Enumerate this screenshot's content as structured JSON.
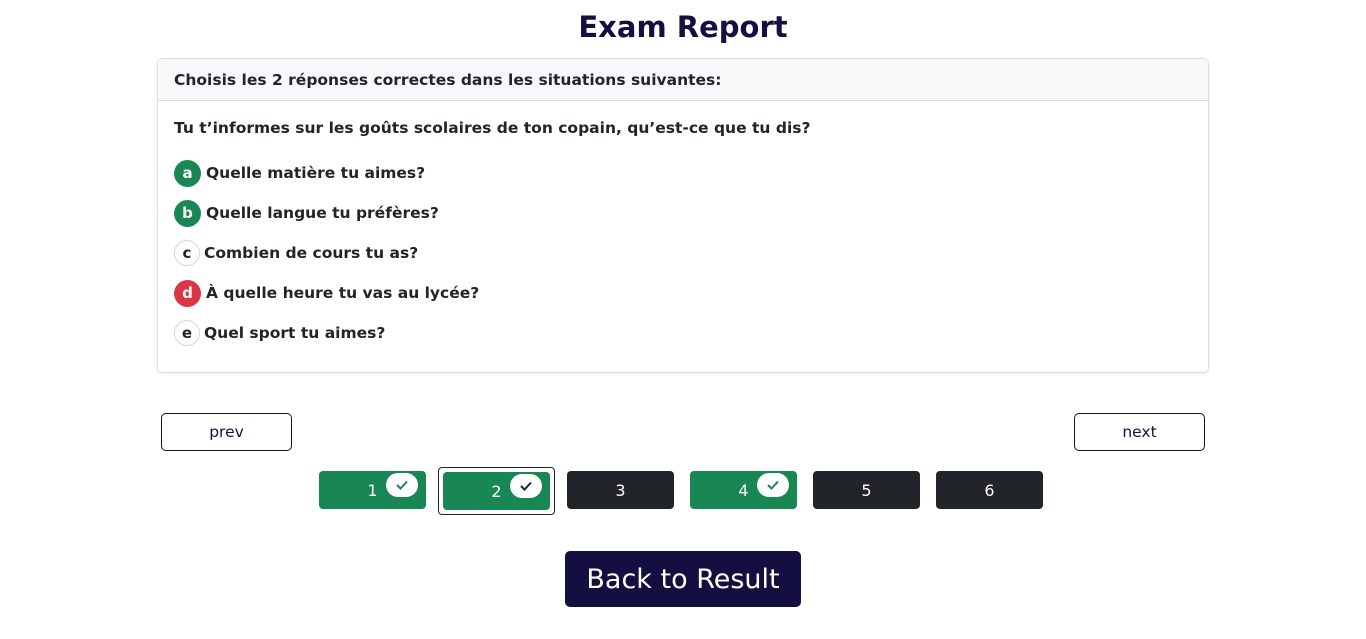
{
  "page": {
    "title": "Exam Report"
  },
  "card": {
    "header": "Choisis les 2 réponses correctes dans les situations suivantes:",
    "question": "Tu t’informes sur les goûts scolaires de ton copain, qu’est-ce que tu dis?",
    "options": [
      {
        "letter": "a",
        "text": "Quelle matière tu aimes?",
        "state": "correct"
      },
      {
        "letter": "b",
        "text": "Quelle langue tu préfères?",
        "state": "correct"
      },
      {
        "letter": "c",
        "text": "Combien de cours tu as?",
        "state": "none"
      },
      {
        "letter": "d",
        "text": "À quelle heure tu vas au lycée?",
        "state": "wrong"
      },
      {
        "letter": "e",
        "text": "Quel sport tu aimes?",
        "state": "none"
      }
    ]
  },
  "nav": {
    "prev_label": "prev",
    "next_label": "next"
  },
  "question_nav": [
    {
      "label": "1",
      "status": "correct",
      "checked": true,
      "active": false
    },
    {
      "label": "2",
      "status": "correct",
      "checked": true,
      "active": true
    },
    {
      "label": "3",
      "status": "unanswered",
      "checked": false,
      "active": false
    },
    {
      "label": "4",
      "status": "correct",
      "checked": true,
      "active": false
    },
    {
      "label": "5",
      "status": "unanswered",
      "checked": false,
      "active": false
    },
    {
      "label": "6",
      "status": "unanswered",
      "checked": false,
      "active": false
    }
  ],
  "back_button": {
    "label": "Back to Result"
  },
  "colors": {
    "primary": "#130f40",
    "correct": "#198754",
    "wrong": "#dc3545",
    "dark": "#212529"
  },
  "icons": {
    "check": "check-icon"
  }
}
